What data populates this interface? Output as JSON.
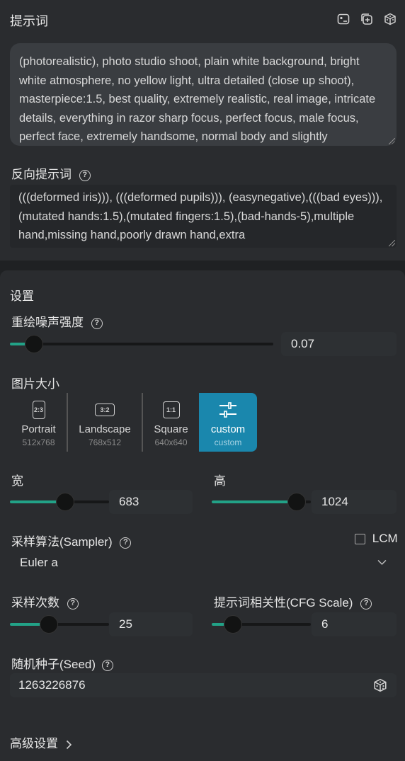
{
  "prompt": {
    "title": "提示词",
    "text": "(photorealistic), photo studio shoot, plain white background, bright white atmosphere, no yellow light, ultra detailed (close up shoot), masterpiece:1.5, best quality, extremely realistic, real image,  intricate details, everything in razor sharp focus, perfect focus, male  focus, perfect face, extremely handsome, normal body and slightly"
  },
  "negative_prompt": {
    "label": "反向提示词",
    "text": "(((deformed iris))), (((deformed pupils))), (easynegative),(((bad eyes))),(mutated hands:1.5),(mutated fingers:1.5),(bad-hands-5),multiple hand,missing hand,poorly drawn hand,extra"
  },
  "settings": {
    "title": "设置",
    "denoise": {
      "label": "重绘噪声强度",
      "value": "0.07",
      "fraction": 0.07
    },
    "image_size": {
      "label": "图片大小",
      "options": [
        {
          "icon_text": "2:3",
          "name": "Portrait",
          "dims": "512x768"
        },
        {
          "icon_text": "3:2",
          "name": "Landscape",
          "dims": "768x512"
        },
        {
          "icon_text": "1:1",
          "name": "Square",
          "dims": "640x640"
        },
        {
          "icon_text": "",
          "name": "custom",
          "dims": "custom"
        }
      ],
      "selected": "custom"
    },
    "width": {
      "label": "宽",
      "value": "683"
    },
    "height": {
      "label": "高",
      "value": "1024"
    },
    "sampler": {
      "label": "采样算法(Sampler)",
      "value": "Euler a",
      "lcm_label": "LCM",
      "lcm_checked": false
    },
    "steps": {
      "label": "采样次数",
      "value": "25"
    },
    "cfg": {
      "label": "提示词相关性(CFG Scale)",
      "value": "6"
    },
    "seed": {
      "label": "随机种子(Seed)",
      "value": "1263226876"
    },
    "advanced": {
      "label": "高级设置"
    }
  },
  "colors": {
    "accent": "#22a287",
    "selected_card": "#1a87ad",
    "background": "#1f2123"
  }
}
